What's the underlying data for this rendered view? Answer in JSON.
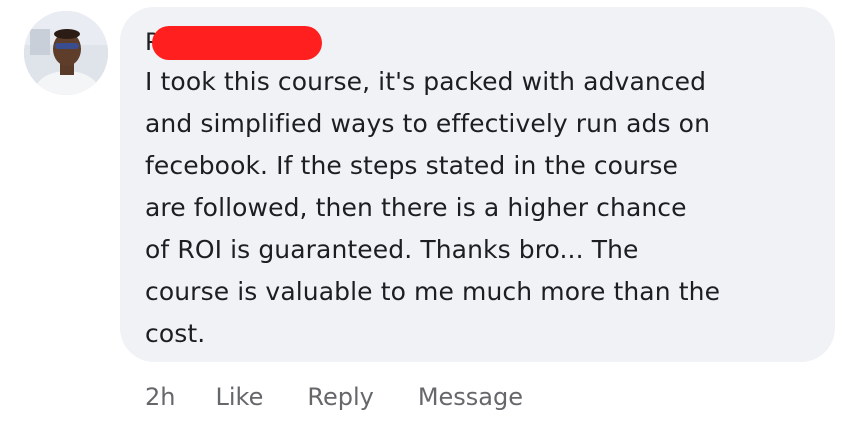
{
  "comment": {
    "author_visible": "P",
    "text_lines": [
      "I took this course, it's packed with advanced",
      "and simplified ways to effectively run ads on",
      "fecebook. If the steps stated in the course",
      "are followed, then there is a higher chance",
      "of ROI is guaranteed. Thanks bro... The",
      "course is valuable to me much more than the",
      "cost."
    ]
  },
  "actions": {
    "time": "2h",
    "like": "Like",
    "reply": "Reply",
    "message": "Message"
  },
  "colors": {
    "bubble": "#f0f2f5",
    "text": "#1c1e21",
    "secondary": "#65676b",
    "redaction": "#ff1f1f"
  }
}
